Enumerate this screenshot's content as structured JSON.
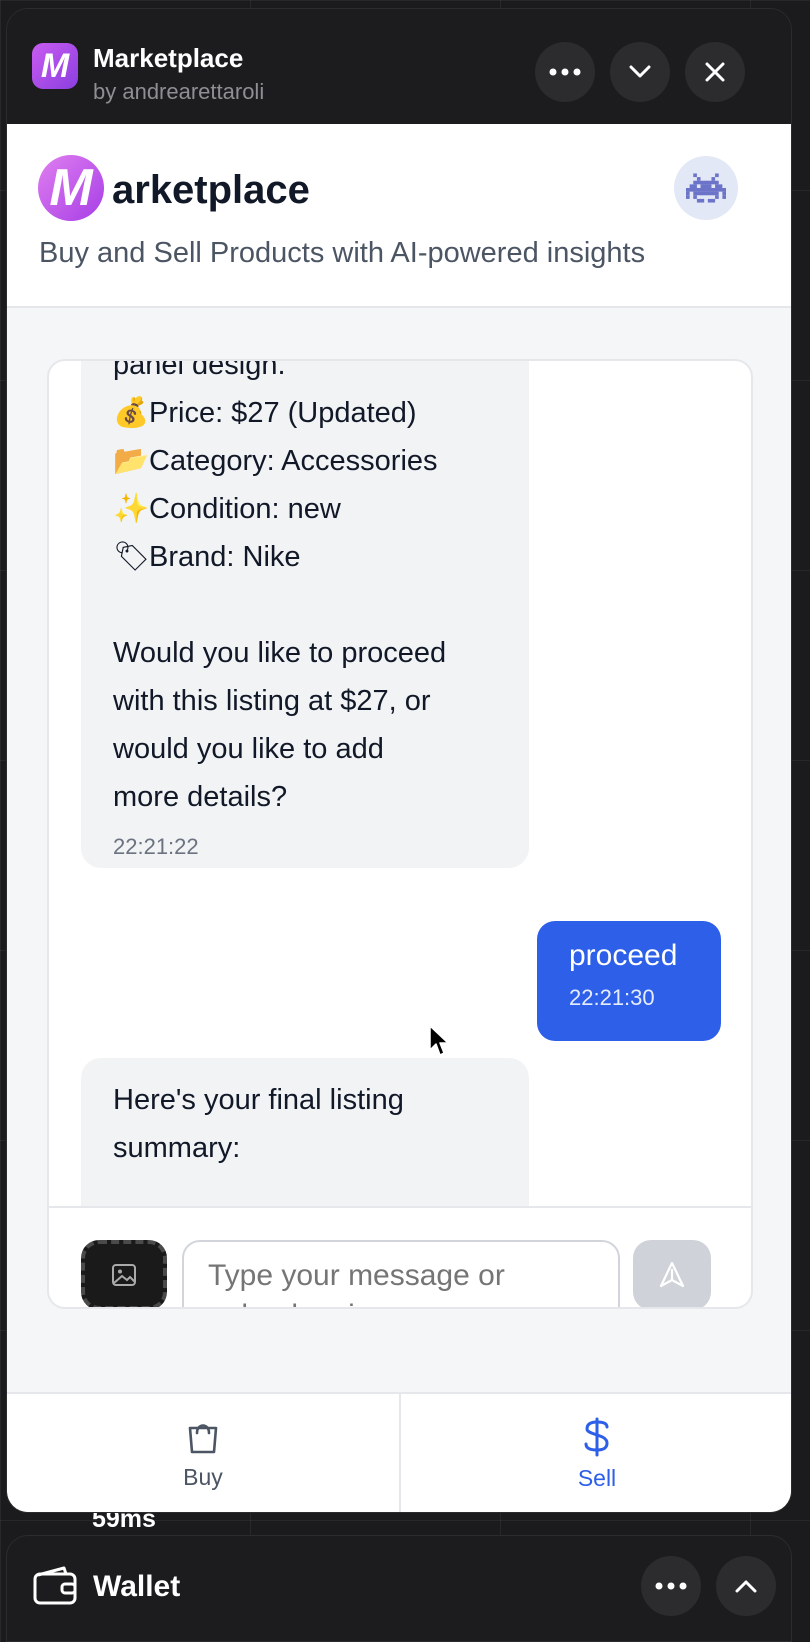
{
  "window": {
    "title": "Marketplace",
    "author": "by andrearettaroli",
    "icon_letter": "M"
  },
  "background": {
    "metric": "59ms"
  },
  "header": {
    "logo_letter": "M",
    "brand_rest": "arketplace",
    "tagline": "Buy and Sell Products with AI-powered insights"
  },
  "chat": {
    "bot_message_1": {
      "lines": [
        "panel design.",
        "Price: $27 (Updated)",
        "Category: Accessories",
        "Condition: new",
        "Brand: Nike",
        "",
        "Would you like to proceed",
        "with this listing at $27, or",
        "would you like to add",
        "more details?"
      ],
      "emojis": [
        "💰",
        "📂",
        "✨",
        "🏷"
      ],
      "time": "22:21:22"
    },
    "user_message": {
      "text": "proceed",
      "time": "22:21:30"
    },
    "bot_message_2": {
      "lines": [
        "Here's your final listing",
        "summary:"
      ]
    },
    "input_placeholder": "Type your message or upload an image..."
  },
  "nav": {
    "buy_label": "Buy",
    "sell_label": "Sell",
    "active": "Sell"
  },
  "wallet": {
    "title": "Wallet"
  },
  "colors": {
    "accent": "#2d5fe8",
    "brand_gradient_start": "#e07ff0",
    "brand_gradient_end": "#a63ee6",
    "bot_bubble": "#f2f3f5"
  }
}
